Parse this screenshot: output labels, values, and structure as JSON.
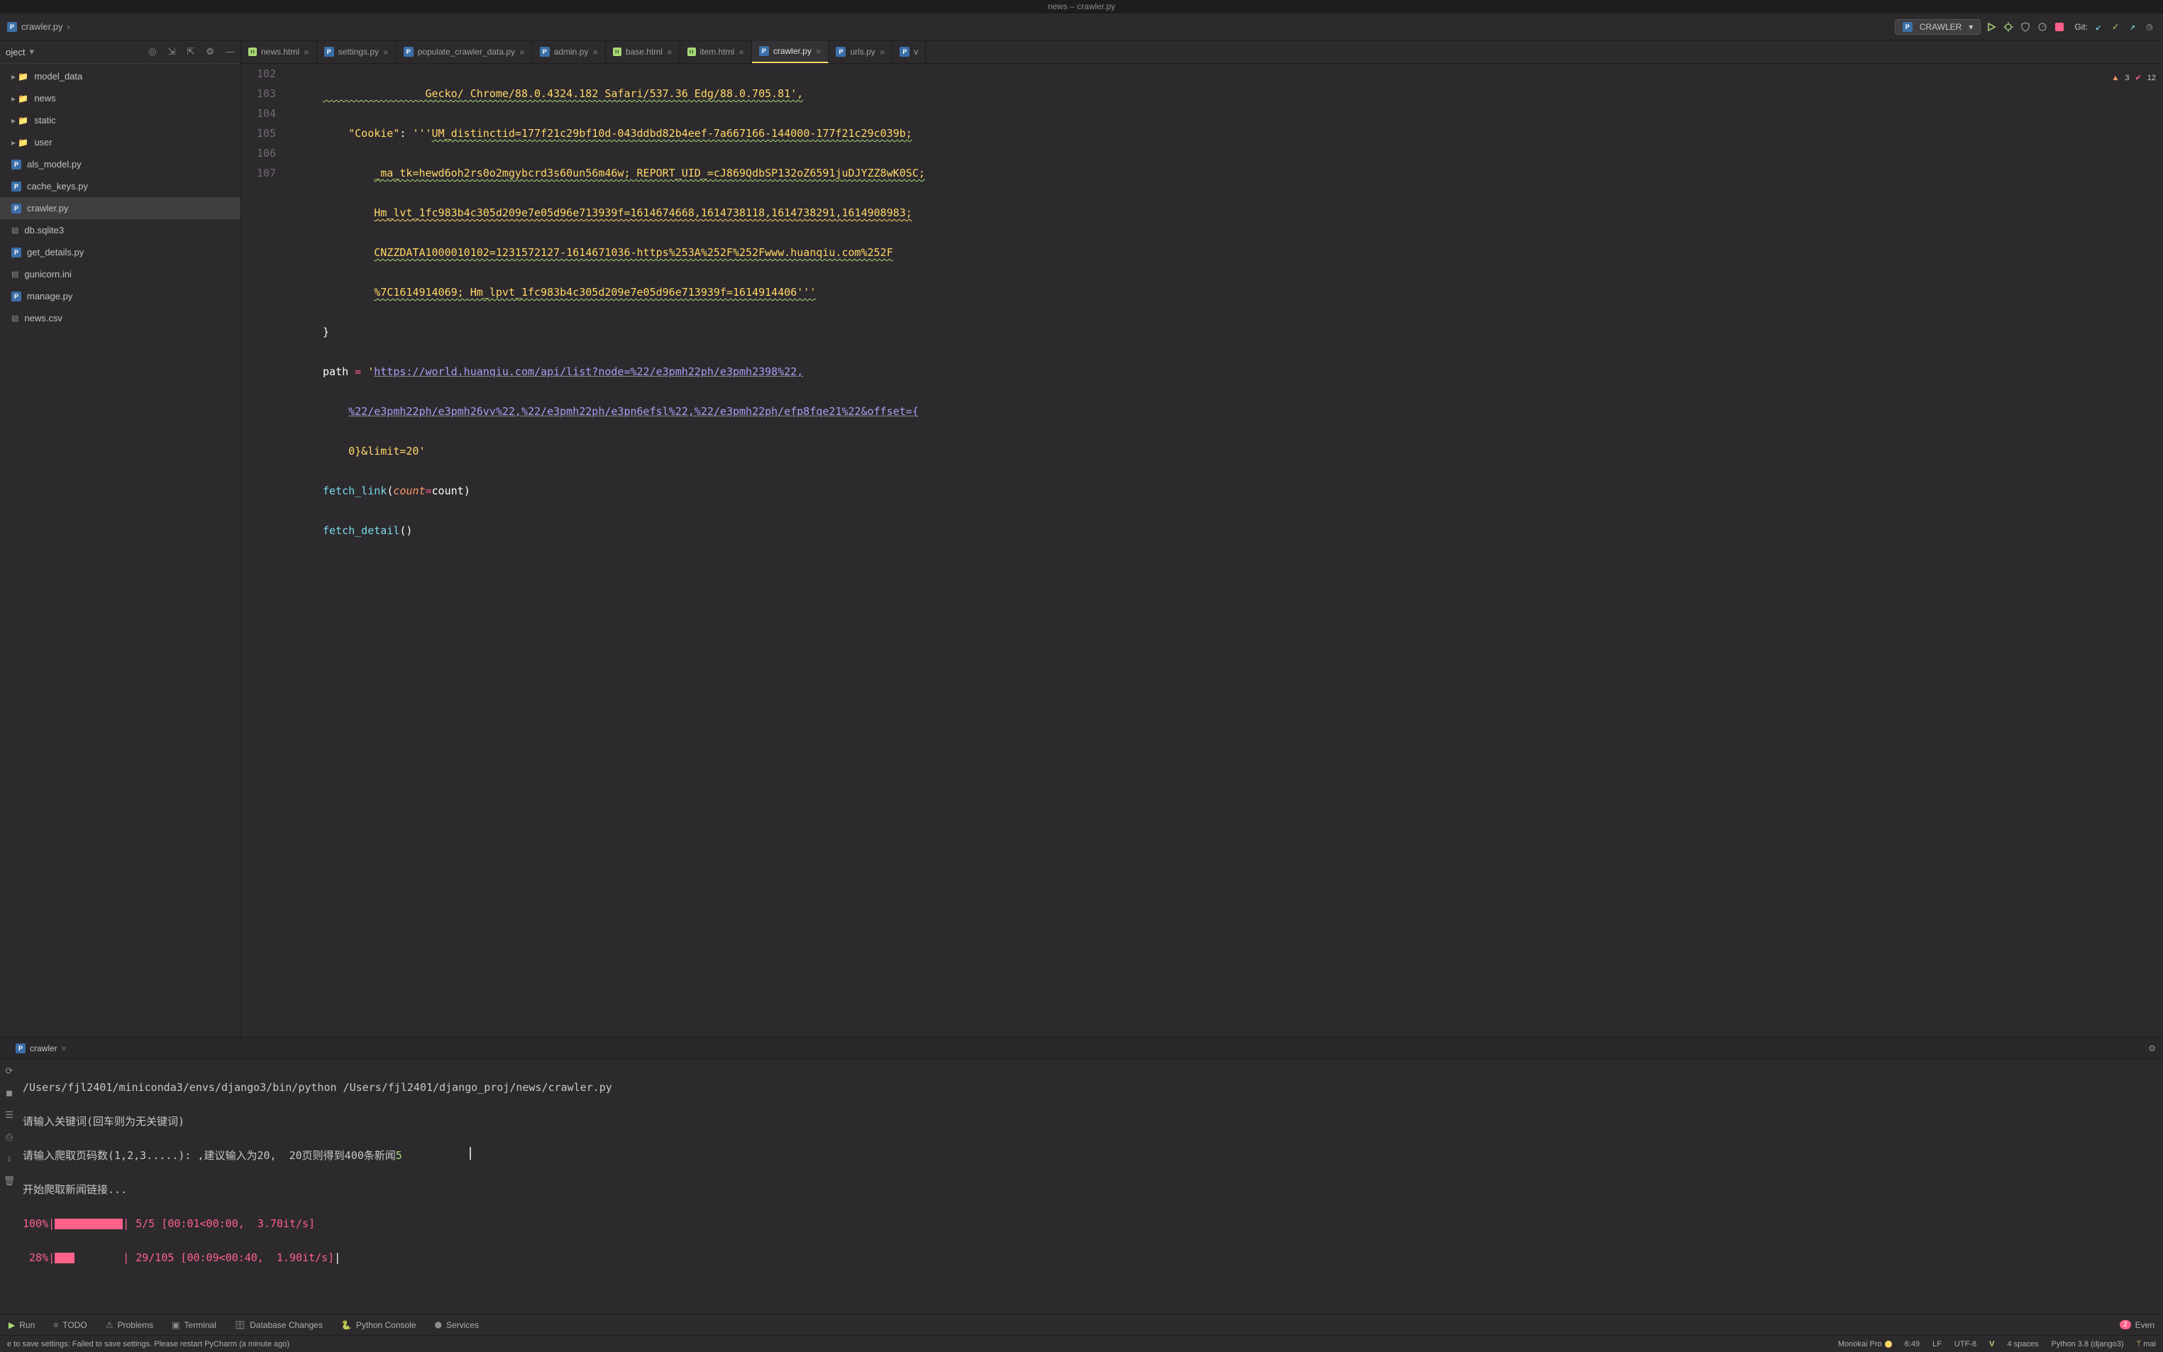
{
  "window_title": "news – crawler.py",
  "breadcrumb": {
    "file": "crawler.py"
  },
  "run_config": {
    "name": "CRAWLER"
  },
  "git_label": "Git:",
  "inspection": {
    "warnings": "3",
    "weak": "12"
  },
  "sidebar": {
    "title": "oject",
    "items": [
      {
        "label": "model_data",
        "type": "folder"
      },
      {
        "label": "news",
        "type": "folder"
      },
      {
        "label": "static",
        "type": "folder"
      },
      {
        "label": "user",
        "type": "folder"
      },
      {
        "label": "als_model.py",
        "type": "py"
      },
      {
        "label": "cache_keys.py",
        "type": "py"
      },
      {
        "label": "crawler.py",
        "type": "py",
        "selected": true
      },
      {
        "label": "db.sqlite3",
        "type": "file"
      },
      {
        "label": "get_details.py",
        "type": "py"
      },
      {
        "label": "gunicorn.ini",
        "type": "file"
      },
      {
        "label": "manage.py",
        "type": "py"
      },
      {
        "label": "news.csv",
        "type": "file"
      }
    ]
  },
  "tabs": [
    {
      "label": "news.html",
      "type": "html"
    },
    {
      "label": "settings.py",
      "type": "py"
    },
    {
      "label": "populate_crawler_data.py",
      "type": "py"
    },
    {
      "label": "admin.py",
      "type": "py"
    },
    {
      "label": "base.html",
      "type": "html"
    },
    {
      "label": "item.html",
      "type": "html"
    },
    {
      "label": "crawler.py",
      "type": "py",
      "active": true
    },
    {
      "label": "urls.py",
      "type": "py"
    },
    {
      "label": "v",
      "type": "py",
      "truncated": true
    }
  ],
  "code": {
    "lines": {
      "l102a": "                Gecko/ Chrome/88.0.4324.182 Safari/537.36 Edg/88.0.705.81',",
      "l103_key": "\"Cookie\"",
      "l103_colon": ": ",
      "l103_str_open": "'''",
      "l103_part1": "UM_distinctid=177f21c29bf10d-043ddbd82b4eef-7a667166-144000-177f21c29c039b;",
      "l103_part2": "_ma_tk=hewd6oh2rs0o2mgybcrd3s60un56m46w; REPORT_UID_=cJ869QdbSP132oZ6591juDJYZZ8wK0SC;",
      "l103_part3": "Hm_lvt_1fc983b4c305d209e7e05d96e713939f=1614674668,1614738118,1614738291,1614908983;",
      "l103_part4": "CNZZDATA1000010102=1231572127-1614671036-https%253A%252F%252Fwww.huanqiu.com%252F",
      "l103_part5": "%7C1614914069; Hm_lpvt_1fc983b4c305d209e7e05d96e713939f=1614914406'''",
      "l104": "}",
      "l105_path": "path",
      "l105_eq": " = ",
      "l105_q": "'",
      "l105_url1": "https://world.huanqiu.com/api/list?node=%22/e3pmh22ph/e3pmh2398%22,",
      "l105_url2": "%22/e3pmh22ph/e3pmh26vv%22,%22/e3pmh22ph/e3pn6efsl%22,%22/e3pmh22ph/efp8fqe21%22&offset={",
      "l105_url3": "0}&limit=20'",
      "l106_call": "fetch_link",
      "l106_args_l": "(",
      "l106_kw": "count",
      "l106_eq": "=",
      "l106_val": "count",
      "l106_args_r": ")",
      "l107_call": "fetch_detail",
      "l107_paren": "()"
    },
    "line_numbers": [
      "102",
      "103",
      "",
      "",
      "",
      "",
      "104",
      "105",
      "",
      "",
      "106",
      "107"
    ]
  },
  "run_tab": {
    "name": "crawler"
  },
  "console": {
    "cmd": "/Users/fjl2401/miniconda3/envs/django3/bin/python /Users/fjl2401/django_proj/news/crawler.py",
    "line1": "请输入关键词(回车则为无关键词)",
    "line2a": "请输入爬取页码数(1,2,3.....): ,建议输入为20,  20页则得到400条新闻",
    "line2b": "5",
    "line3": "开始爬取新闻链接...",
    "p1_pct": "100%",
    "p1_stat": " 5/5 [00:01<00:00,  3.70it/s]",
    "p2_pct": " 28%",
    "p2_stat": " 29/105 [00:09<00:40,  1.90it/s]"
  },
  "bottom_buttons": {
    "run": "Run",
    "todo": "TODO",
    "problems": "Problems",
    "terminal": "Terminal",
    "db": "Database Changes",
    "pyconsole": "Python Console",
    "services": "Services",
    "events": "Even",
    "event_count": "2"
  },
  "status": {
    "msg": "e to save settings: Failed to save settings. Please restart PyCharm (a minute ago)",
    "theme": "Monokai Pro",
    "cursor": "6:49",
    "line_sep": "LF",
    "encoding": "UTF-8",
    "indent": "4 spaces",
    "interpreter": "Python 3.8 (django3)",
    "branch": "mai"
  }
}
